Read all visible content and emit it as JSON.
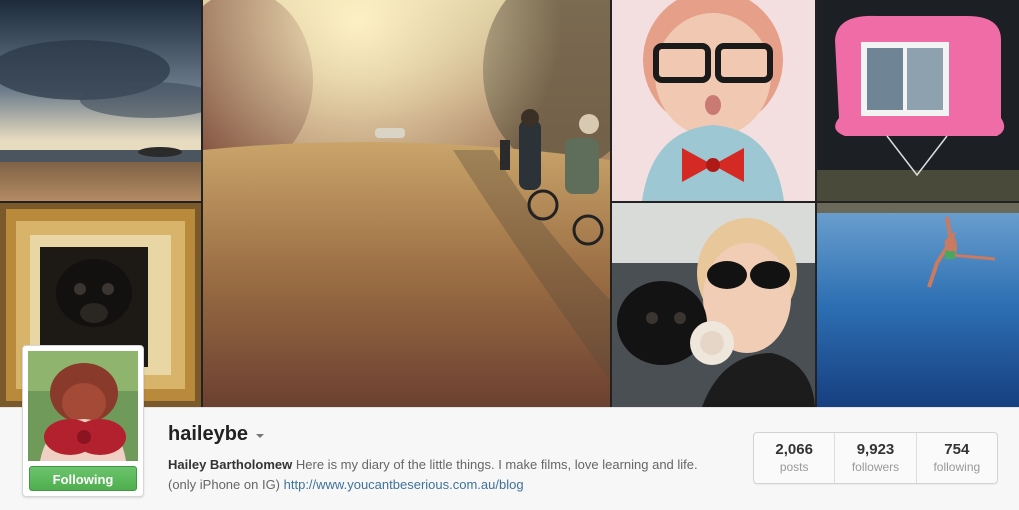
{
  "profile": {
    "username": "haileybe",
    "full_name": "Hailey Bartholomew",
    "bio": "Here is my diary of the little things. I make films, love learning and life. (only iPhone on IG)",
    "website": "http://www.youcantbeserious.com.au/blog",
    "follow_button": "Following"
  },
  "stats": [
    {
      "value": "2,066",
      "label": "posts"
    },
    {
      "value": "9,923",
      "label": "followers"
    },
    {
      "value": "754",
      "label": "following"
    }
  ],
  "colors": {
    "follow_green": "#5cb85c",
    "link_blue": "#3f729b"
  },
  "icons": {
    "dropdown": "caret-down-icon"
  }
}
